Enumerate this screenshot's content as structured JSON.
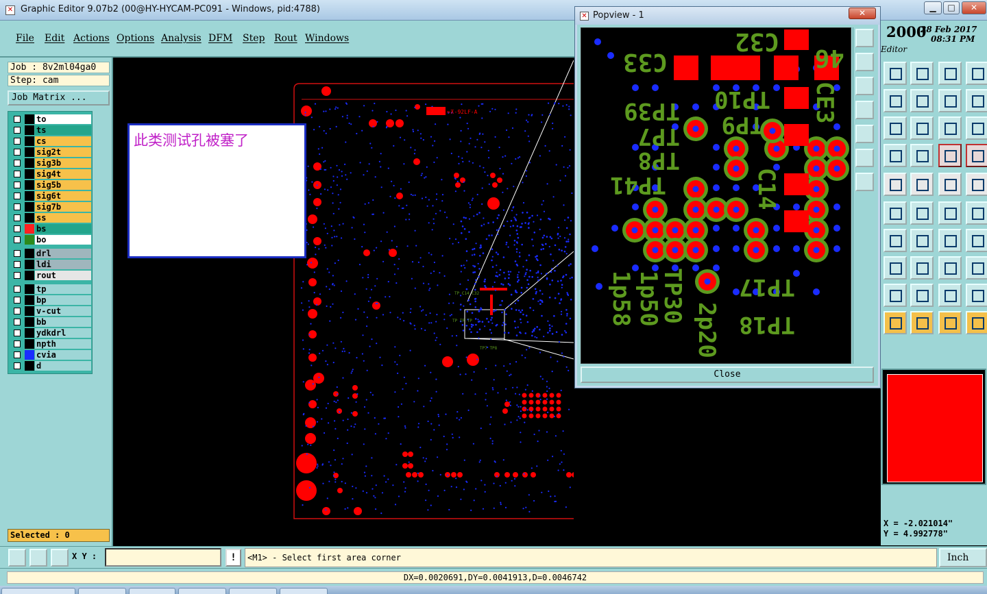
{
  "window": {
    "title": "Graphic Editor 9.07b2 (00@HY-HYCAM-PC091 - Windows, pid:4788)",
    "minimize": "▁",
    "maximize": "□",
    "close": "✕"
  },
  "menu": [
    "File",
    "Edit",
    "Actions",
    "Options",
    "Analysis",
    "DFM",
    "Step",
    "Rout",
    "Windows"
  ],
  "job": {
    "job_label": "Job : 8v2ml04ga0",
    "step_label": "Step: cam",
    "job_matrix": "Job Matrix ..."
  },
  "layers": {
    "group1": [
      {
        "name": "to",
        "color": "#ffffff"
      },
      {
        "name": "ts",
        "color": "#23a58c"
      },
      {
        "name": "cs",
        "color": "#f7c14a"
      },
      {
        "name": "sig2t",
        "color": "#f7c14a"
      },
      {
        "name": "sig3b",
        "color": "#f7c14a"
      },
      {
        "name": "sig4t",
        "color": "#f7c14a"
      },
      {
        "name": "sig5b",
        "color": "#f7c14a"
      },
      {
        "name": "sig6t",
        "color": "#f7c14a"
      },
      {
        "name": "sig7b",
        "color": "#f7c14a"
      },
      {
        "name": "ss",
        "color": "#f7c14a"
      },
      {
        "name": "bs",
        "color": "#23a58c",
        "swatch": "#ff2020"
      },
      {
        "name": "bo",
        "color": "#ffffff",
        "swatch": "#2c8a1c"
      }
    ],
    "group2": [
      {
        "name": "drl",
        "color": "#9fb6bd"
      },
      {
        "name": "ldi",
        "color": "#9fb6bd"
      },
      {
        "name": "rout",
        "color": "#e6e6e6"
      }
    ],
    "group3": [
      {
        "name": "tp",
        "color": "#9ed6d6"
      },
      {
        "name": "bp",
        "color": "#9ed6d6"
      },
      {
        "name": "v-cut",
        "color": "#9ed6d6"
      },
      {
        "name": "bb",
        "color": "#9ed6d6"
      },
      {
        "name": "ydkdrl",
        "color": "#9ed6d6"
      },
      {
        "name": "npth",
        "color": "#9ed6d6"
      },
      {
        "name": "cvia",
        "color": "#9ed6d6",
        "swatch": "#1a2cff"
      },
      {
        "name": "d",
        "color": "#9ed6d6"
      }
    ]
  },
  "selected": "Selected : 0",
  "annotation": "此类测试孔被塞了",
  "popview": {
    "title": "Popview - 1",
    "close_x": "✕",
    "close_button": "Close",
    "labels": [
      "46",
      "C32",
      "C33",
      "TP10",
      "TP39",
      "TP9",
      "TP7",
      "TP8",
      "TP41",
      "CE3",
      "C14",
      "TP17",
      "TP18",
      "1p58",
      "1p50",
      "TP30",
      "2p20"
    ]
  },
  "clock": {
    "year": "2000",
    "date": "28 Feb 2017",
    "time": "08:31 PM",
    "label": "Editor"
  },
  "coords": {
    "x": "X = -2.021014\"",
    "y": "Y = 4.992778\""
  },
  "command": {
    "xy_label": "X Y :",
    "xy_value": "",
    "warn": "!",
    "prompt": "<M1> - Select first area corner",
    "units": "Inch"
  },
  "status": {
    "measure": "DX=0.0020691,DY=0.0041913,D=0.0046742"
  },
  "colors": {
    "panel": "#9ed6d6",
    "pad_red": "#ff0000",
    "silk_green": "#5d9a1f",
    "via_blue": "#1a2cff"
  }
}
